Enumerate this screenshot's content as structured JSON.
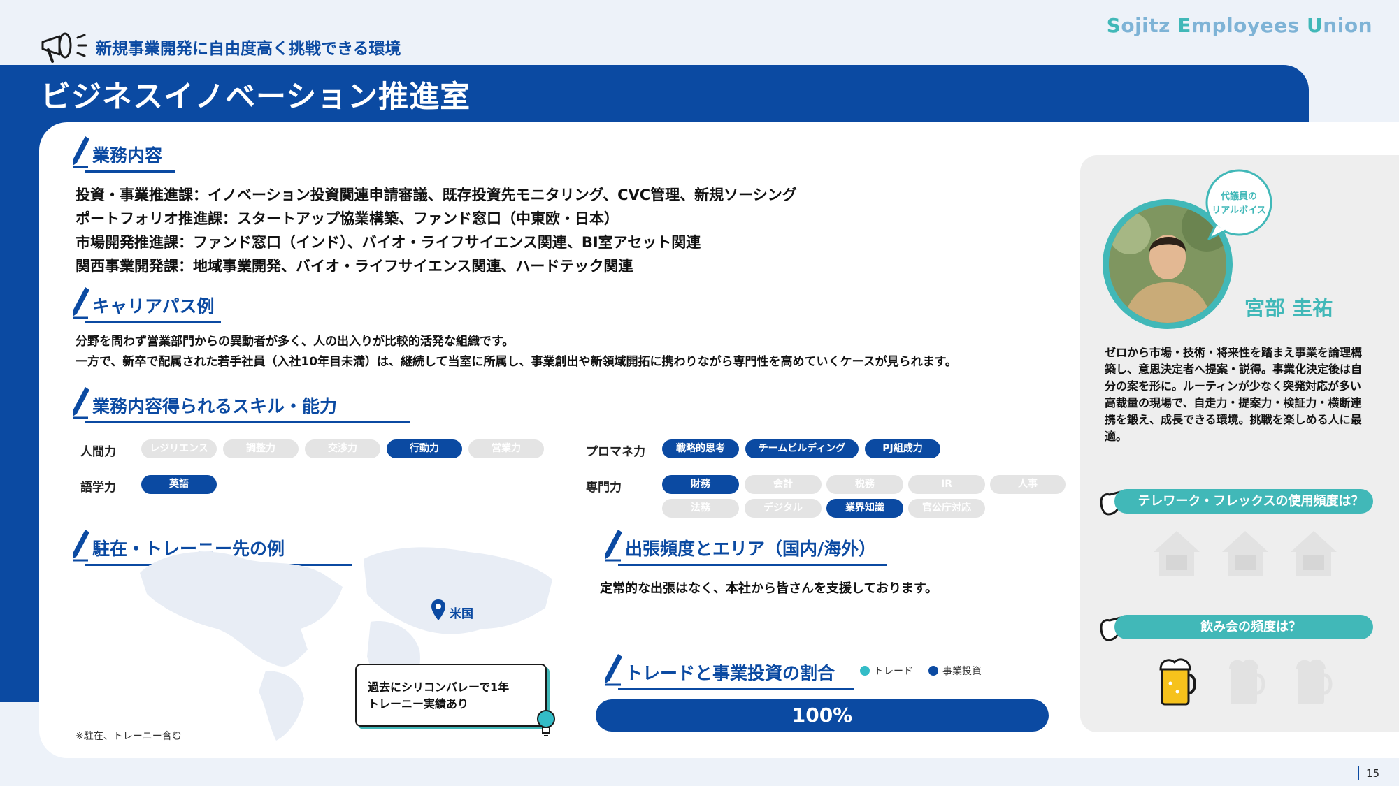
{
  "header": {
    "tagline": "新規事業開発に自由度高く挑戦できる環境",
    "brand": [
      {
        "initial": "S",
        "rest": "ojitz "
      },
      {
        "initial": "E",
        "rest": "mployees "
      },
      {
        "initial": "U",
        "rest": "nion"
      }
    ]
  },
  "page_title": "ビジネスイノベーション推進室",
  "duties": {
    "heading": "業務内容",
    "lines": [
      "投資・事業推進課：イノベーション投資関連申請審議、既存投資先モニタリング、CVC管理、新規ソーシング",
      "ポートフォリオ推進課：スタートアップ協業構築、ファンド窓口（中東欧・日本）",
      "市場開発推進課：ファンド窓口（インド）、バイオ・ライフサイエンス関連、BI室アセット関連",
      "関西事業開発課：地域事業開発、バイオ・ライフサイエンス関連、ハードテック関連"
    ]
  },
  "career": {
    "heading": "キャリアパス例",
    "lines": [
      "分野を問わず営業部門からの異動者が多く、人の出入りが比較的活発な組織です。",
      "一方で、新卒で配属された若手社員（入社10年目未満）は、継続して当室に所属し、事業創出や新領域開拓に携わりながら専門性を高めていくケースが見られます。"
    ]
  },
  "skills": {
    "heading": "業務内容得られるスキル・能力",
    "groups": {
      "human": {
        "label": "人間力",
        "items": [
          {
            "text": "レジリエンス",
            "on": false
          },
          {
            "text": "調整力",
            "on": false
          },
          {
            "text": "交渉力",
            "on": false
          },
          {
            "text": "行動力",
            "on": true
          },
          {
            "text": "営業力",
            "on": false
          }
        ]
      },
      "language": {
        "label": "語学力",
        "items": [
          {
            "text": "英語",
            "on": true
          }
        ]
      },
      "pm": {
        "label": "プロマネ力",
        "items": [
          {
            "text": "戦略的思考",
            "on": true
          },
          {
            "text": "チームビルディング",
            "on": true
          },
          {
            "text": "PJ組成力",
            "on": true
          }
        ]
      },
      "expertise": {
        "label": "専門力",
        "items": [
          {
            "text": "財務",
            "on": true
          },
          {
            "text": "会計",
            "on": false
          },
          {
            "text": "税務",
            "on": false
          },
          {
            "text": "IR",
            "on": false
          },
          {
            "text": "人事",
            "on": false
          },
          {
            "text": "法務",
            "on": false
          },
          {
            "text": "デジタル",
            "on": false
          },
          {
            "text": "業界知識",
            "on": true
          },
          {
            "text": "官公庁対応",
            "on": false
          }
        ]
      }
    }
  },
  "postings": {
    "heading": "駐在・トレーニー先の例",
    "locations": [
      {
        "name": "米国"
      }
    ],
    "callout": [
      "過去にシリコンバレーで1年",
      "トレーニー実績あり"
    ],
    "footnote": "※駐在、トレーニー含む"
  },
  "travel": {
    "heading": "出張頻度とエリア（国内/海外）",
    "text": "定常的な出張はなく、本社から皆さんを支援しております。"
  },
  "ratio": {
    "heading": "トレードと事業投資の割合",
    "legend": [
      {
        "label": "トレード",
        "color": "#33bcc7"
      },
      {
        "label": "事業投資",
        "color": "#0b4aa2"
      }
    ],
    "investment_percent": 100,
    "label": "100%"
  },
  "representative": {
    "bubble_lines": [
      "代議員の",
      "リアルボイス"
    ],
    "name": "宮部 圭祐",
    "voice": "ゼロから市場・技術・将来性を踏まえ事業を論理構築し、意思決定者へ提案・説得。事業化決定後は自分の案を形に。ルーティンが少なく突発対応が多い高裁量の現場で、自走力・提案力・検証力・横断連携を鍛え、成長できる環境。挑戦を楽しめる人に最適。"
  },
  "telework": {
    "question": "テレワーク・フレックスの使用頻度は？",
    "level": 0,
    "max": 3
  },
  "drinking": {
    "question": "飲み会の頻度は？",
    "level": 1,
    "max": 3
  },
  "page_number": "15",
  "colors": {
    "navy": "#0b4aa2",
    "teal": "#41b8b8",
    "inactive": "#e4e4e4"
  }
}
